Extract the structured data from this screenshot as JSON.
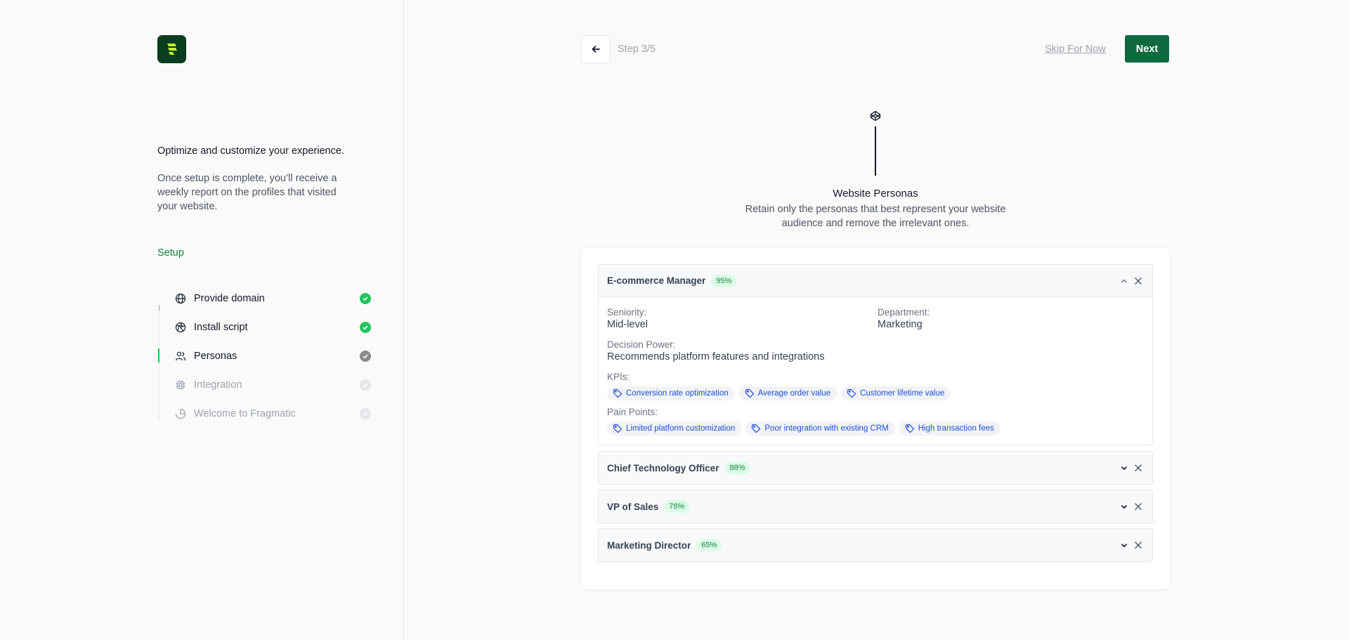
{
  "sidebar": {
    "intro_title": "Optimize and customize your experience.",
    "intro_body": "Once setup is complete, you’ll receive a weekly report on the profiles that visited your website.",
    "setup_label": "Setup",
    "steps": [
      {
        "label": "Provide domain",
        "icon": "globe-icon",
        "status": "done"
      },
      {
        "label": "Install script",
        "icon": "aperture-icon",
        "status": "done"
      },
      {
        "label": "Personas",
        "icon": "users-icon",
        "status": "current"
      },
      {
        "label": "Integration",
        "icon": "chip-icon",
        "status": "pending"
      },
      {
        "label": "Welcome to Fragmatic",
        "icon": "pie-chart-icon",
        "status": "pending"
      }
    ]
  },
  "header": {
    "step_counter": "Step 3/5",
    "skip_label": "Skip For Now",
    "next_label": "Next"
  },
  "hero": {
    "title": "Website Personas",
    "description": "Retain only the personas that best represent your website audience and remove the irrelevant ones."
  },
  "personas": [
    {
      "name": "E-commerce Manager",
      "score": "95%",
      "expanded": true,
      "seniority_label": "Seniority:",
      "seniority": "Mid-level",
      "department_label": "Department:",
      "department": "Marketing",
      "decision_label": "Decision Power:",
      "decision": "Recommends platform features and integrations",
      "kpis_label": "KPIs:",
      "kpis": [
        "Conversion rate optimization",
        "Average order value",
        "Customer lifetime value"
      ],
      "pains_label": "Pain Points:",
      "pains": [
        "Limited platform customization",
        "Poor integration with existing CRM",
        "High transaction fees"
      ]
    },
    {
      "name": "Chief Technology Officer",
      "score": "88%",
      "expanded": false
    },
    {
      "name": "VP of Sales",
      "score": "78%",
      "expanded": false
    },
    {
      "name": "Marketing Director",
      "score": "65%",
      "expanded": false
    }
  ],
  "colors": {
    "brand": "#0e6b40",
    "success": "#22c55e",
    "badge_text": "#15803d",
    "tag_text": "#1d4ed8"
  }
}
